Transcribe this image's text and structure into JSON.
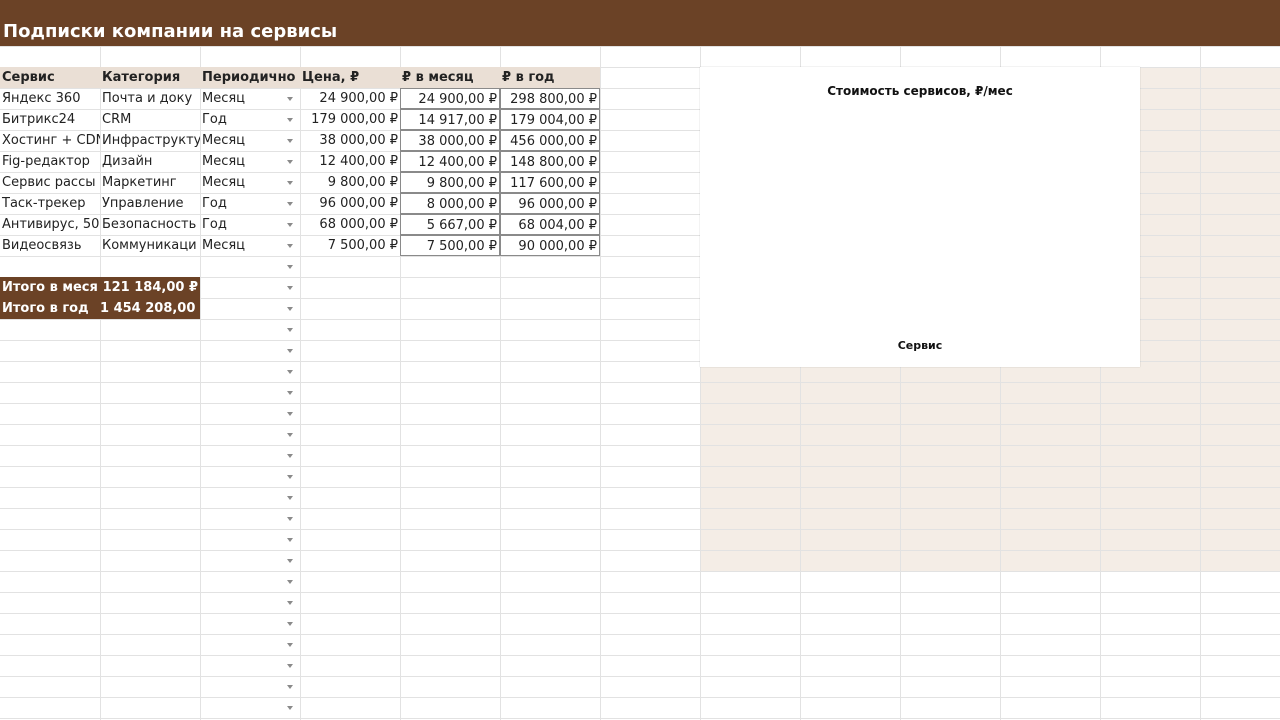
{
  "sheet": {
    "title": "Подписки компании на сервисы",
    "headers": [
      "Сервис",
      "Категория",
      "Периодично",
      "Цена, ₽",
      "₽ в месяц",
      "₽ в год"
    ],
    "rows": [
      [
        "Яндекс 360",
        "Почта и доку",
        "Месяц",
        "24 900,00 ₽",
        "24 900,00 ₽",
        "298 800,00 ₽"
      ],
      [
        "Битрикс24",
        "CRM",
        "Год",
        "179 000,00 ₽",
        "14 917,00 ₽",
        "179 004,00 ₽"
      ],
      [
        "Хостинг + CDN",
        "Инфраструкту",
        "Месяц",
        "38 000,00 ₽",
        "38 000,00 ₽",
        "456 000,00 ₽"
      ],
      [
        "Fig-редактор",
        "Дизайн",
        "Месяц",
        "12 400,00 ₽",
        "12 400,00 ₽",
        "148 800,00 ₽"
      ],
      [
        "Сервис рассы",
        "Маркетинг",
        "Месяц",
        "9 800,00 ₽",
        "9 800,00 ₽",
        "117 600,00 ₽"
      ],
      [
        "Таск-трекер",
        "Управление",
        "Год",
        "96 000,00 ₽",
        "8 000,00 ₽",
        "96 000,00 ₽"
      ],
      [
        "Антивирус, 50",
        "Безопасность",
        "Год",
        "68 000,00 ₽",
        "5 667,00 ₽",
        "68 004,00 ₽"
      ],
      [
        "Видеосвязь",
        "Коммуникаци",
        "Месяц",
        "7 500,00 ₽",
        "7 500,00 ₽",
        "90 000,00 ₽"
      ]
    ],
    "totals": {
      "monthly_label": "Итого в меся",
      "monthly_value": "121 184,00 ₽",
      "yearly_label": "Итого в год",
      "yearly_value": "1 454 208,00 ₽"
    }
  },
  "chart": {
    "title": "Стоимость сервисов, ₽/мес",
    "xlabel": "Сервис"
  },
  "colors": {
    "title_band": "#6b4226",
    "header_fill": "#eadfd5",
    "totals_fill": "#6b4226",
    "pane_fill": "#f4ede6",
    "gridline": "#e2e2e2"
  },
  "icons": {
    "dropdown": "chevron-down-icon"
  }
}
